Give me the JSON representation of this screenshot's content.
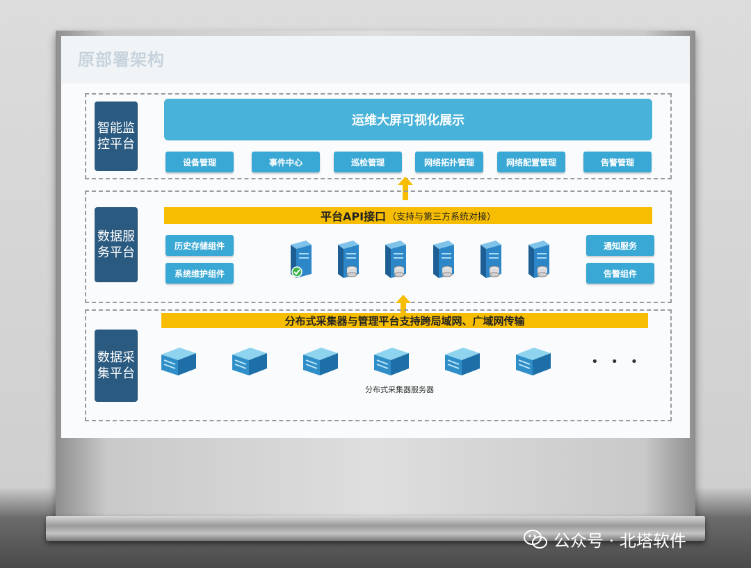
{
  "slide": {
    "title": "原部署架构"
  },
  "layers": {
    "smart": {
      "label": "智能监控平台",
      "banner": "运维大屏可视化展示",
      "modules": [
        "设备管理",
        "事件中心",
        "巡检管理",
        "网络拓扑管理",
        "网络配置管理",
        "告警管理"
      ]
    },
    "data_service": {
      "label": "数据服务平台",
      "bar_main": "平台API接口",
      "bar_note": "（支持与第三方系统对接）",
      "left_components": [
        "历史存储组件",
        "系统维护组件"
      ],
      "right_components": [
        "通知服务",
        "告警组件"
      ]
    },
    "collection": {
      "label": "数据采集平台",
      "bar": "分布式采集器与管理平台支持跨局域网、广域网传输",
      "caption": "分布式采集器服务器",
      "dots": "• • •"
    }
  },
  "watermark": {
    "text": "公众号 · 北塔软件"
  },
  "colors": {
    "accent": "#3aa8d4",
    "yellow": "#f7bd00",
    "side": "#2a5a80"
  }
}
